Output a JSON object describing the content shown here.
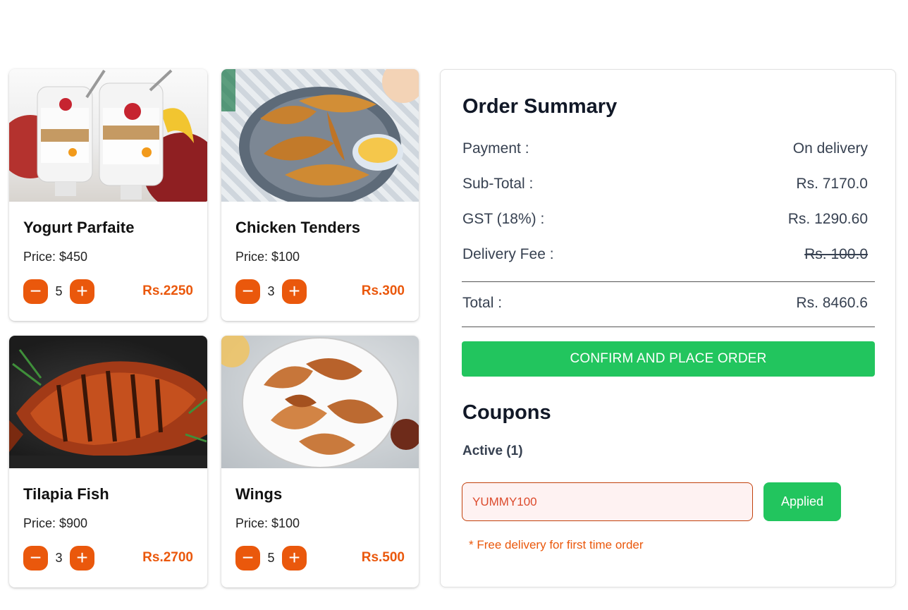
{
  "items": [
    {
      "name": "Yogurt Parfaite",
      "price": "Price: $450",
      "qty": "5",
      "total": "Rs.2250",
      "image": "yogurt-parfait-image"
    },
    {
      "name": "Chicken Tenders",
      "price": "Price: $100",
      "qty": "3",
      "total": "Rs.300",
      "image": "chicken-tenders-image"
    },
    {
      "name": "Tilapia Fish",
      "price": "Price: $900",
      "qty": "3",
      "total": "Rs.2700",
      "image": "tilapia-fish-image"
    },
    {
      "name": "Wings",
      "price": "Price: $100",
      "qty": "5",
      "total": "Rs.500",
      "image": "wings-image"
    }
  ],
  "controls": {
    "minus": "−",
    "plus": "+"
  },
  "summary": {
    "title": "Order Summary",
    "payment_label": "Payment :",
    "payment_value": "On delivery",
    "subtotal_label": "Sub-Total :",
    "subtotal_value": "Rs. 7170.0",
    "gst_label": "GST (18%) :",
    "gst_value": "Rs. 1290.60",
    "delivery_label": "Delivery Fee :",
    "delivery_value": "Rs. 100.0",
    "total_label": "Total :",
    "total_value": "Rs. 8460.6",
    "confirm_label": "CONFIRM AND PLACE ORDER"
  },
  "coupons": {
    "title": "Coupons",
    "active_label": "Active (1)",
    "code": "YUMMY100",
    "apply_label": "Applied",
    "note": "* Free delivery for first time order"
  },
  "colors": {
    "accent": "#ea580c",
    "success": "#22c55e"
  }
}
